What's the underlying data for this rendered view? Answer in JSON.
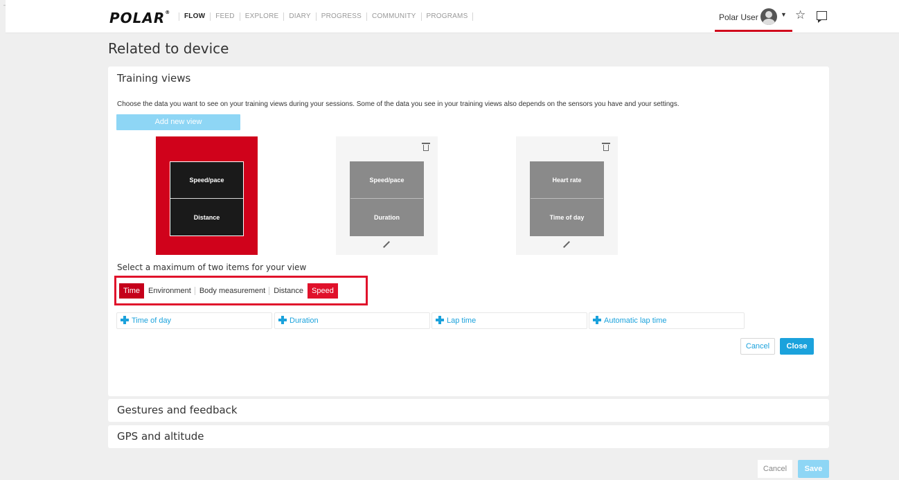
{
  "header": {
    "logo": "POLAR",
    "nav": [
      {
        "label": "FLOW",
        "active": true
      },
      {
        "label": "FEED"
      },
      {
        "label": "EXPLORE"
      },
      {
        "label": "DIARY"
      },
      {
        "label": "PROGRESS"
      },
      {
        "label": "COMMUNITY"
      },
      {
        "label": "PROGRAMS"
      }
    ],
    "user_name": "Polar User",
    "star_icon": "☆"
  },
  "page_title": "Related to device",
  "training_views": {
    "title": "Training views",
    "description": "Choose the data you want to see on your training views during your sessions. Some of the data you see in your training views also depends on the sensors you have and your settings.",
    "add_view_label": "Add new view",
    "views": [
      {
        "fields": [
          "Speed/pace",
          "Distance"
        ],
        "selected": true
      },
      {
        "fields": [
          "Speed/pace",
          "Duration"
        ],
        "selected": false
      },
      {
        "fields": [
          "Heart rate",
          "Time of day"
        ],
        "selected": false
      }
    ],
    "select_label": "Select a maximum of two items for your view",
    "categories": [
      "Time",
      "Environment",
      "Body measurement",
      "Distance",
      "Speed"
    ],
    "options": [
      "Time of day",
      "Duration",
      "Lap time",
      "Automatic lap time"
    ],
    "cancel_label": "Cancel",
    "close_label": "Close"
  },
  "sections": [
    "Gestures and feedback",
    "GPS and altitude"
  ],
  "footer": {
    "cancel_label": "Cancel",
    "save_label": "Save"
  },
  "colors": {
    "polar_red": "#d0021b",
    "accent_blue": "#1ba2dc",
    "light_blue": "#8ed6f5"
  }
}
